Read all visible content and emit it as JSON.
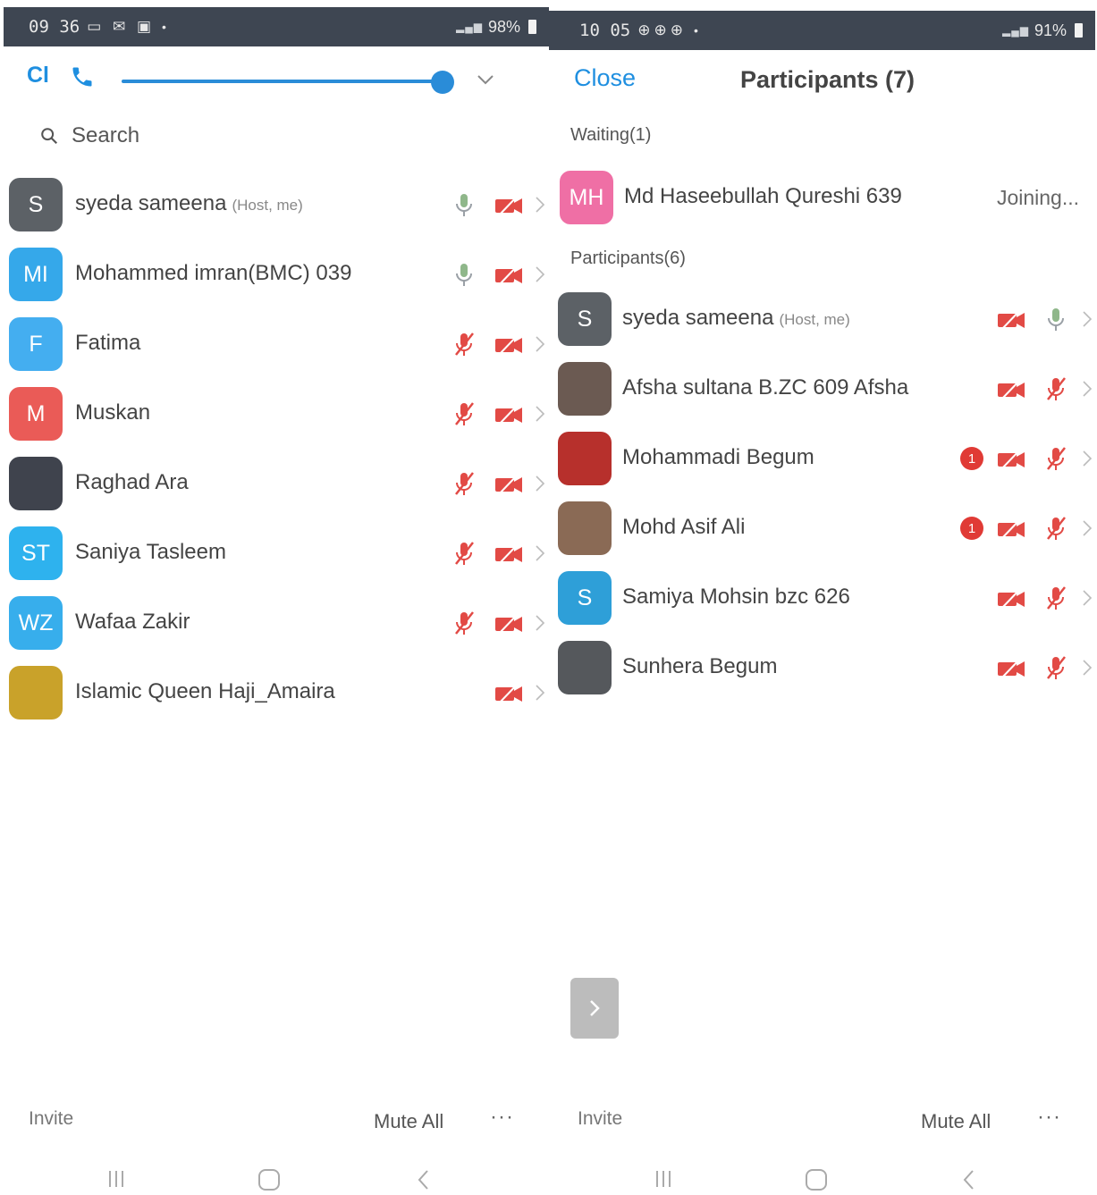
{
  "left": {
    "status": {
      "time": "09 36",
      "battery": "98%"
    },
    "header": {
      "cl_label": "Cl"
    },
    "search": {
      "placeholder": "Search"
    },
    "participants": [
      {
        "name": "syeda sameena",
        "tag": "(Host, me)",
        "initials": "S",
        "color": "#5c6166",
        "mic": "on",
        "video": "off"
      },
      {
        "name": "Mohammed imran(BMC) 039",
        "tag": "",
        "initials": "MI",
        "color": "#35a8ea",
        "mic": "on",
        "video": "off"
      },
      {
        "name": "Fatima",
        "tag": "",
        "initials": "F",
        "color": "#44aef0",
        "mic": "off",
        "video": "off"
      },
      {
        "name": "Muskan",
        "tag": "",
        "initials": "M",
        "color": "#ea5b57",
        "mic": "off",
        "video": "off"
      },
      {
        "name": "Raghad Ara",
        "tag": "",
        "initials": "",
        "color": "#3f434d",
        "mic": "off",
        "video": "off"
      },
      {
        "name": "Saniya Tasleem",
        "tag": "",
        "initials": "ST",
        "color": "#2eb2ee",
        "mic": "off",
        "video": "off"
      },
      {
        "name": "Wafaa Zakir",
        "tag": "",
        "initials": "WZ",
        "color": "#37aeec",
        "mic": "off",
        "video": "off"
      },
      {
        "name": "Islamic Queen Haji_Amaira",
        "tag": "",
        "initials": "",
        "color": "#c9a22a",
        "mic": "none",
        "video": "off"
      }
    ],
    "footer": {
      "invite": "Invite",
      "mute_all": "Mute All",
      "more": "···"
    }
  },
  "right": {
    "status": {
      "time": "10 05",
      "battery": "91%"
    },
    "header": {
      "close": "Close",
      "title": "Participants (7)"
    },
    "waiting_label": "Waiting(1)",
    "waiting": [
      {
        "name": "Md Haseebullah Qureshi 639",
        "initials": "MH",
        "color": "#ef6fa5",
        "status": "Joining..."
      }
    ],
    "participants_label": "Participants(6)",
    "participants": [
      {
        "name": "syeda sameena",
        "tag": "(Host, me)",
        "initials": "S",
        "color": "#5c6166",
        "mic": "on",
        "badge": ""
      },
      {
        "name": "Afsha sultana B.ZC 609 Afsha",
        "tag": "",
        "initials": "",
        "color": "#6b5a52",
        "mic": "off",
        "badge": ""
      },
      {
        "name": "Mohammadi Begum",
        "tag": "",
        "initials": "",
        "color": "#b7302c",
        "mic": "off",
        "badge": "1"
      },
      {
        "name": "Mohd Asif Ali",
        "tag": "",
        "initials": "",
        "color": "#8a6a55",
        "mic": "off",
        "badge": "1"
      },
      {
        "name": "Samiya Mohsin bzc 626",
        "tag": "",
        "initials": "S",
        "color": "#2e9fd8",
        "mic": "off",
        "badge": ""
      },
      {
        "name": "Sunhera Begum",
        "tag": "",
        "initials": "",
        "color": "#55585c",
        "mic": "off",
        "badge": ""
      }
    ],
    "footer": {
      "invite": "Invite",
      "mute_all": "Mute All",
      "more": "···"
    }
  },
  "colors": {
    "accent": "#1f8fe0",
    "muted_red": "#e24a45"
  },
  "icons": {
    "mic_on": "microphone-icon",
    "mic_off": "microphone-muted-icon",
    "video_off": "video-off-icon",
    "chevron": "chevron-right-icon"
  }
}
